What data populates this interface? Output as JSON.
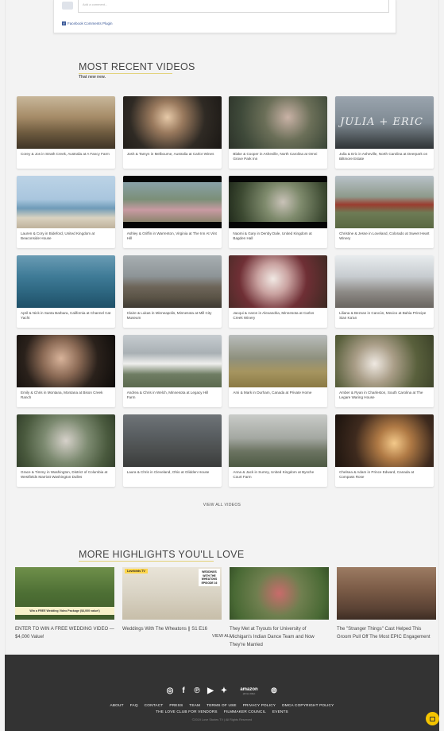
{
  "facebook": {
    "placeholder": "Add a comment...",
    "plugin_label": "Facebook Comments Plugin"
  },
  "recent": {
    "title": "MOST RECENT VIDEOS",
    "subtitle": "That new new.",
    "videos": [
      {
        "caption": "Corey & Jos in Strath Creek, Australia at A Fancy Farm",
        "thumb": "linear-gradient(180deg,#c8b79a 0%,#a58b67 40%,#6d5a3f 70%,#3e3426 100%)"
      },
      {
        "caption": "Josh & Tamyn in Melbourne, Australia at Carlor Wines",
        "thumb": "radial-gradient(circle at 45% 40%,#e6c9a8 0%,#9a7a5e 25%,#2f2a24 60%,#1a1714 100%)"
      },
      {
        "caption": "Blake & Cooper in Asheville, North Carolina at Omni Grove Park Inn",
        "thumb": "radial-gradient(circle at 60% 40%,#c9b2a6 0%,#6b6f58 35%,#3f4a3a 70%,#2c3229 100%)"
      },
      {
        "caption": "Julia & Eric in Asheville, North Carolina at Deerpark on Biltmore Estate",
        "thumb": "linear-gradient(180deg,#9aa4ae 0%,#7f8a93 50%,#4e5559 80%,#2f3336 100%)",
        "script": "JULIA + ERIC"
      },
      {
        "caption": "Lauren & Cory in Bideford, United Kingdom at Beaconside House",
        "thumb": "linear-gradient(180deg,#bcd3e6 0%,#a9c6de 45%,#6f9bb8 62%,#d9d2c0 80%,#bfb29c 100%)"
      },
      {
        "caption": "Ashley & Griffin in Warrenton, Virginia at The Inn At Vint Hill",
        "thumb": "linear-gradient(180deg,#8ea7b9 0%,#7b8f78 45%,#c89aa2 65%,#6c7a52 100%)",
        "letterbox": true
      },
      {
        "caption": "Naomi & Gary in Denby Dale, United Kingdom at Bagden Hall",
        "thumb": "radial-gradient(circle at 55% 50%,#c9c2b8 0%,#7f8b6d 30%,#3d4a32 70%,#1d2619 100%)",
        "letterbox": true
      },
      {
        "caption": "Christine & Jesse in Loveland, Colorado at Sweet Heart Winery",
        "thumb": "linear-gradient(180deg,#b8c2c9 0%,#8e9a8b 40%,#9b3c2f 55%,#6e7b55 70%,#596842 100%)"
      },
      {
        "caption": "April & Nick in Santa Barbara, California at Channel Cat Yacht",
        "thumb": "linear-gradient(180deg,#6a9cb4 0%,#3f7b97 40%,#2d6680 70%,#1f5068 100%)"
      },
      {
        "caption": "Claire & Lukas in Minneapolis, Minnesota at Mill City Museum",
        "thumb": "linear-gradient(180deg,#a8afb2 0%,#8d9497 40%,#6d6559 60%,#5b5447 80%,#3e3a33 100%)"
      },
      {
        "caption": "Jacqui & Aaron in Alexandria, Minnesota at Carlos Creek Winery",
        "thumb": "radial-gradient(circle at 45% 45%,#f1e9e4 0%,#c9a2a0 25%,#6f2f35 55%,#3c2a22 100%)"
      },
      {
        "caption": "Liliana & Bezvan in Cancún, Mexico at Bahia Principe Sian Ka'an",
        "thumb": "linear-gradient(180deg,#e8ecee 0%,#c7ccd0 40%,#8d8a86 70%,#6a6560 100%)"
      },
      {
        "caption": "Emily & Chris in Montana, Montana at Bison Creek Ranch",
        "thumb": "radial-gradient(circle at 45% 45%,#d8b39a 0%,#8b6a55 30%,#2a211b 60%,#0e0c0a 100%)"
      },
      {
        "caption": "Andrea & Chris in Welch, Minnesota at Legacy Hill Farm",
        "thumb": "linear-gradient(180deg,#c6ccd0 0%,#a9b0b4 35%,#efefed 55%,#6f7d63 75%,#5c6a4f 100%)"
      },
      {
        "caption": "Ami & Mark in Durham, Canada at Private Home",
        "thumb": "linear-gradient(180deg,#b9bdbc 0%,#8e907d 45%,#a69560 70%,#8b7a44 100%)"
      },
      {
        "caption": "Amber & Ryan in Charleston, South Carolina at The Legare Waring House",
        "thumb": "radial-gradient(circle at 40% 55%,#efe9e2 0%,#a99d87 30%,#59603c 65%,#3c4229 100%)"
      },
      {
        "caption": "Grace & Timmy in Washington, District of Columbia at Westfields Marriott Washington Dulles",
        "thumb": "radial-gradient(circle at 50% 50%,#d6d1ca 0%,#7c8a70 40%,#4a5a3e 75%,#33402b 100%)"
      },
      {
        "caption": "Laura & Chris in Cleveland, Ohio at Glidden House",
        "thumb": "linear-gradient(180deg,#6f7478 0%,#595e61 40%,#4b4e4e 70%,#3a3c3b 100%)"
      },
      {
        "caption": "Anna & Jack in Surrey, United Kingdom at Bysche Court Farm",
        "thumb": "linear-gradient(180deg,#c9cbc8 0%,#a4a8a2 45%,#6c7462 70%,#4d5a43 100%)"
      },
      {
        "caption": "Chelsea & Adam in Prince Edward, Canada at Compass Rose",
        "thumb": "radial-gradient(circle at 60% 55%,#f3c98a 0%,#b07a45 25%,#3e2a1e 60%,#1a120d 100%)"
      }
    ],
    "view_all": "VIEW ALL VIDEOS"
  },
  "highlights": {
    "title": "MORE HIGHLIGHTS YOU'LL LOVE",
    "items": [
      {
        "title": "ENTER TO WIN A FREE WEDDING VIDEO — $4,000 Value!",
        "thumb": "linear-gradient(180deg,#6f8f4a 0%,#4d6f34 50%,#3f5b2b 100%)",
        "banner": "Win a FREE Wedding Video Package ($4,000 value!)"
      },
      {
        "title": "Weddings With The Wheatons || S1 E16",
        "thumb": "linear-gradient(180deg,#e9e4d8 0%,#d9d3c4 50%,#c7bea9 100%)",
        "lovebird": "Lovebirds TV",
        "tag": "WEDDINGS WITH THE WHEATONS EPISODE 16"
      },
      {
        "title": "They Met at Tryouts for University of Michigan's Indian Dance Team and Now They're Married",
        "thumb": "radial-gradient(circle at 50% 50%,#c96b6b 0%,#6f7f4f 40%,#4a6a35 80%,#375228 100%)"
      },
      {
        "title": "The \"Stranger Things\" Cast Helped This Groom Pull Off The Most EPIC Engagement",
        "thumb": "linear-gradient(180deg,#9c7b63 0%,#7d5d48 40%,#5a4234 80%,#3d2d23 100%)"
      }
    ],
    "view_all": "VIEW ALL"
  },
  "footer": {
    "icons": [
      "instagram-icon",
      "facebook-icon",
      "pinterest-icon",
      "youtube-icon",
      "twitter-icon",
      "amazon-icon",
      "podcast-icon"
    ],
    "amazon_text": "amazon",
    "amazon_sub": "prime video",
    "links_row1": [
      "ABOUT",
      "FAQ",
      "CONTACT",
      "PRESS",
      "TEAM",
      "TERMS OF USE",
      "PRIVACY POLICY",
      "DMCA COPYRIGHT POLICY"
    ],
    "links_row2": [
      "THE LOVE CLUB FOR VENDORS",
      "FILMMAKER COUNCIL",
      "EVENTS"
    ],
    "copyright": "©2019 Love Stories TV | All Rights Reserved"
  }
}
